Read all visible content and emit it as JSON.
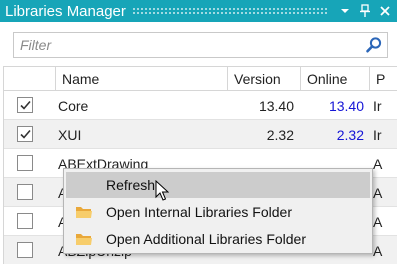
{
  "window": {
    "title": "Libraries Manager"
  },
  "filter": {
    "placeholder": "Filter",
    "value": ""
  },
  "columns": {
    "name": "Name",
    "version": "Version",
    "online": "Online",
    "p": "P"
  },
  "rows": [
    {
      "checked": true,
      "name": "Core",
      "version": "13.40",
      "online": "13.40",
      "p": "Ir"
    },
    {
      "checked": true,
      "name": "XUI",
      "version": "2.32",
      "online": "2.32",
      "p": "Ir"
    },
    {
      "checked": false,
      "name": "ABExtDrawing",
      "version": "",
      "online": "",
      "p": "A"
    },
    {
      "checked": false,
      "name": "A",
      "version": "",
      "online": "",
      "p": "A"
    },
    {
      "checked": false,
      "name": "A",
      "version": "",
      "online": "",
      "p": "A"
    },
    {
      "checked": false,
      "name": "ABZipUnzip",
      "version": "",
      "online": "",
      "p": "A"
    }
  ],
  "context_menu": {
    "items": [
      {
        "label": "Refresh",
        "icon": "none",
        "highlighted": true
      },
      {
        "label": "Open Internal Libraries Folder",
        "icon": "folder-icon",
        "highlighted": false
      },
      {
        "label": "Open Additional Libraries Folder",
        "icon": "folder-icon",
        "highlighted": false
      }
    ]
  },
  "colors": {
    "titlebar": "#17a5b8",
    "online_version": "#1515d6",
    "menu_highlight": "#cccccc",
    "folder": "#f0b848"
  }
}
